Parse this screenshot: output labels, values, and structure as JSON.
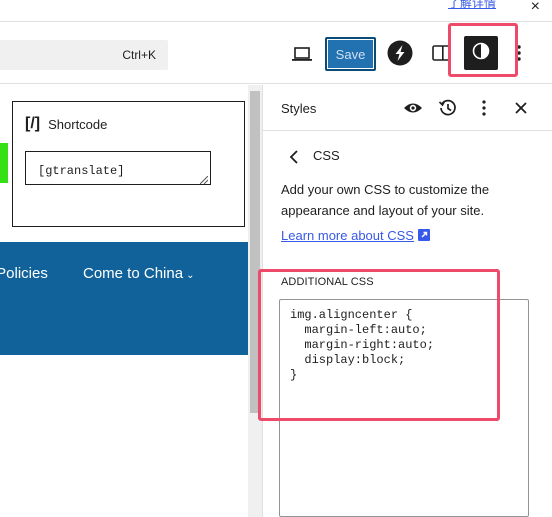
{
  "top_strip": {
    "link_text": "了解详情",
    "close_glyph": "×"
  },
  "toolbar": {
    "command_shortcut": "Ctrl+K",
    "save_label": "Save"
  },
  "canvas": {
    "shortcode_block": {
      "icon_text": "[/]",
      "title": "Shortcode",
      "value": "[gtranslate]"
    },
    "nav": {
      "item_policies": "Policies",
      "item_china": "Come to China",
      "chevron": "⌄"
    }
  },
  "sidebar": {
    "styles_title": "Styles",
    "back_glyph": "‹",
    "css_title": "CSS",
    "description": "Add your own CSS to customize the appearance and layout of your site.",
    "learn_more": "Learn more about CSS",
    "additional_label": "ADDITIONAL CSS",
    "css_code": "img.aligncenter {\n  margin-left:auto;\n  margin-right:auto;\n  display:block;\n}"
  },
  "colors": {
    "save_bg": "#2271b1",
    "nav_band": "#11629a",
    "highlight": "#ee4b6a",
    "link": "#3858e9",
    "green_chip": "#35e014"
  },
  "icons": [
    "close-icon",
    "monitor-icon",
    "plugin-s-icon",
    "sidebar-icon",
    "half-circle-icon",
    "kebab-icon",
    "eye-icon",
    "history-icon",
    "chevron-left-icon",
    "external-link-icon"
  ]
}
